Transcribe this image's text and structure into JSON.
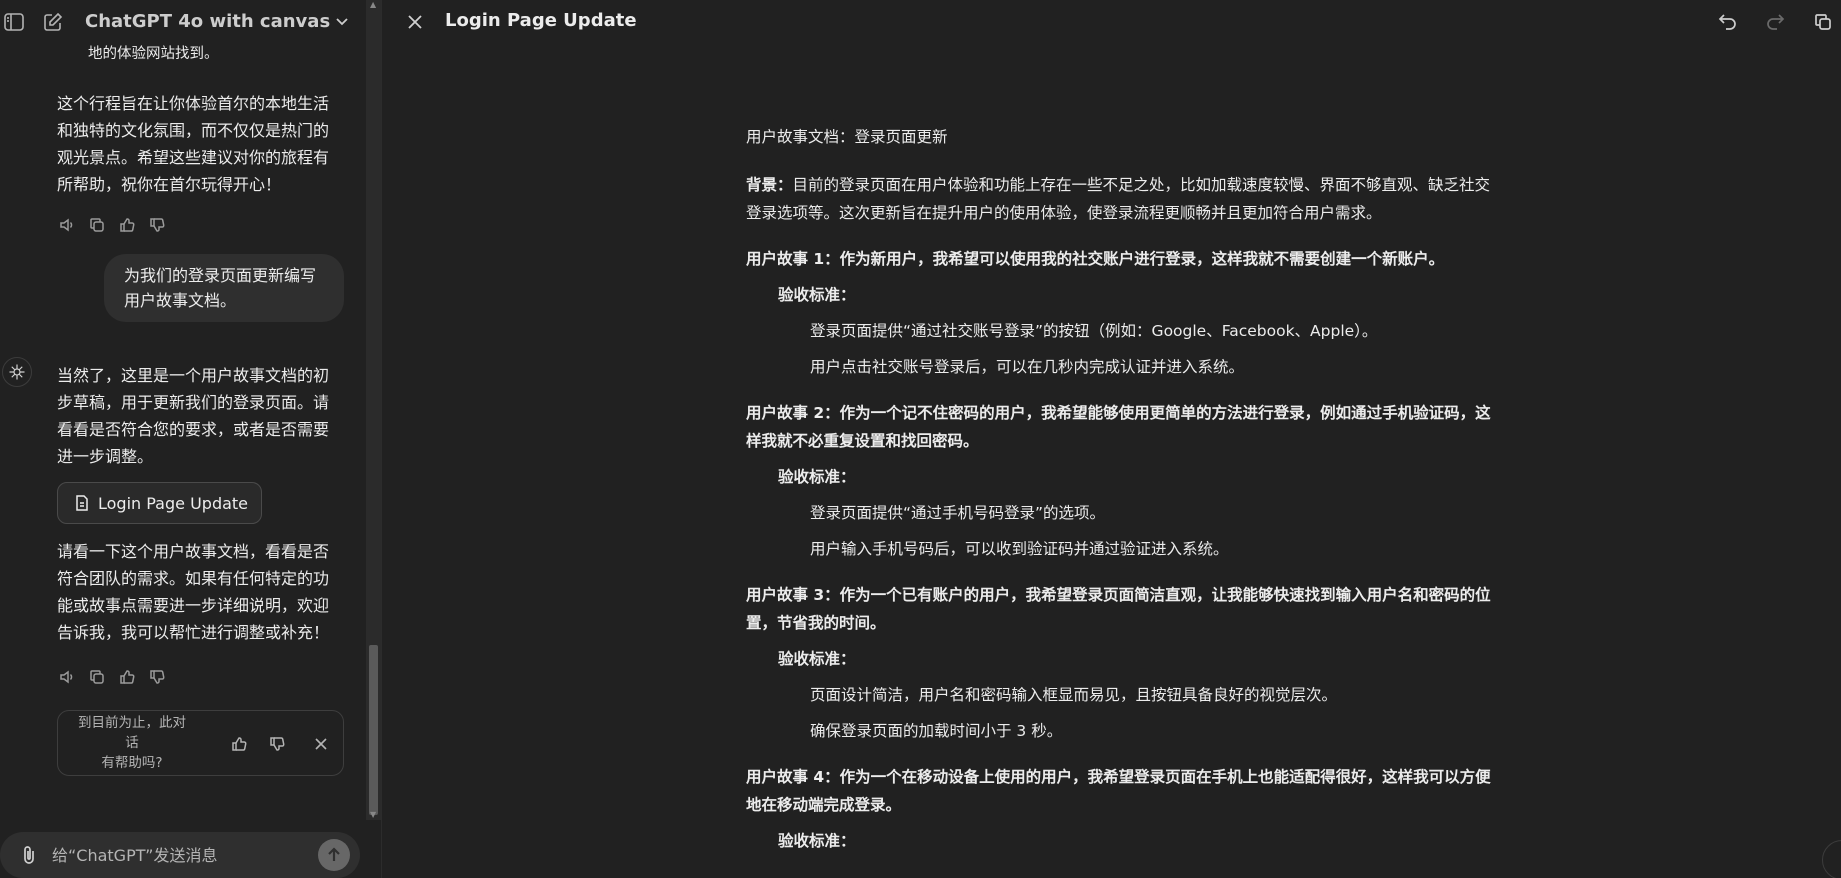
{
  "chat": {
    "model_title": "ChatGPT 4o with canvas",
    "msg_fragment": "地的体验网站找到。",
    "msg_closing": [
      "这个行程旨在让你体验首尔的本地生活",
      "和独特的文化氛围，而不仅仅是热门的",
      "观光景点。希望这些建议对你的旅程有",
      "所帮助，祝你在首尔玩得开心！"
    ],
    "user_message": [
      "为我们的登录页面更新编写",
      "用户故事文档。"
    ],
    "assistant_intro": [
      "当然了，这里是一个用户故事文档的初",
      "步草稿，用于更新我们的登录页面。请",
      "看看是否符合您的要求，或者是否需要",
      "进一步调整。"
    ],
    "canvas_chip_label": "Login Page Update",
    "assistant_outro": [
      "请看一下这个用户故事文档，看看是否",
      "符合团队的需求。如果有任何特定的功",
      "能或故事点需要进一步详细说明，欢迎",
      "告诉我，我可以帮忙进行调整或补充！"
    ],
    "feedback_prompt": [
      "到目前为止，此对话",
      "有帮助吗?"
    ],
    "composer_placeholder": "给“ChatGPT”发送消息"
  },
  "canvas": {
    "title": "Login Page Update",
    "doc": {
      "heading": "用户故事文档：登录页面更新",
      "background_label": "背景：",
      "background_lines": [
        "目前的登录页面在用户体验和功能上存在一些不足之处，比如加载速度较慢、界面不够直观、缺乏社交",
        "登录选项等。这次更新旨在提升用户的使用体验，使登录流程更顺畅并且更加符合用户需求。"
      ],
      "acceptance_label": "验收标准：",
      "stories": [
        {
          "lines": [
            "用户故事 1：作为新用户，我希望可以使用我的社交账户进行登录，这样我就不需要创建一个新账户。"
          ],
          "criteria": [
            "登录页面提供“通过社交账号登录”的按钮（例如：Google、Facebook、Apple）。",
            "用户点击社交账号登录后，可以在几秒内完成认证并进入系统。"
          ]
        },
        {
          "lines": [
            "用户故事 2：作为一个记不住密码的用户，我希望能够使用更简单的方法进行登录，例如通过手机验证码，这",
            "样我就不必重复设置和找回密码。"
          ],
          "criteria": [
            "登录页面提供“通过手机号码登录”的选项。",
            "用户输入手机号码后，可以收到验证码并通过验证进入系统。"
          ]
        },
        {
          "lines": [
            "用户故事 3：作为一个已有账户的用户，我希望登录页面简洁直观，让我能够快速找到输入用户名和密码的位",
            "置，节省我的时间。"
          ],
          "criteria": [
            "页面设计简洁，用户名和密码输入框显而易见，且按钮具备良好的视觉层次。",
            "确保登录页面的加载时间小于 3 秒。"
          ]
        },
        {
          "lines": [
            "用户故事 4：作为一个在移动设备上使用的用户，我希望登录页面在手机上也能适配得很好，这样我可以方便",
            "地在移动端完成登录。"
          ],
          "criteria": []
        }
      ]
    }
  }
}
